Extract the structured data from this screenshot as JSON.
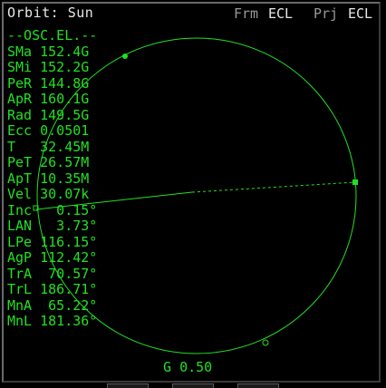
{
  "header": {
    "title": "Orbit: Sun",
    "frame_label": "Frm",
    "frame_value": "ECL",
    "projection_label": "Prj",
    "projection_value": "ECL"
  },
  "elements": {
    "heading": "--OSC.EL.--",
    "rows": [
      {
        "label": "SMa",
        "value": "152.4G"
      },
      {
        "label": "SMi",
        "value": "152.2G"
      },
      {
        "label": "PeR",
        "value": "144.8G"
      },
      {
        "label": "ApR",
        "value": "160.1G"
      },
      {
        "label": "Rad",
        "value": "149.5G"
      },
      {
        "label": "Ecc",
        "value": "0.0501"
      },
      {
        "label": "T",
        "value": "32.45M"
      },
      {
        "label": "PeT",
        "value": "26.57M"
      },
      {
        "label": "ApT",
        "value": "10.35M"
      },
      {
        "label": "Vel",
        "value": "30.07k"
      },
      {
        "label": "Inc",
        "value": "  0.15°"
      },
      {
        "label": "LAN",
        "value": "  3.73°"
      },
      {
        "label": "LPe",
        "value": "116.15°"
      },
      {
        "label": "AgP",
        "value": "112.42°"
      },
      {
        "label": "TrA",
        "value": " 70.57°"
      },
      {
        "label": "TrL",
        "value": "186.71°"
      },
      {
        "label": "MnA",
        "value": " 65.22°"
      },
      {
        "label": "MnL",
        "value": "181.36°"
      }
    ]
  },
  "gauge": {
    "label": "G",
    "value": "0.50"
  },
  "colors": {
    "green": "#22e022",
    "white": "#e8e8e8",
    "gray": "#9a9a9a"
  }
}
